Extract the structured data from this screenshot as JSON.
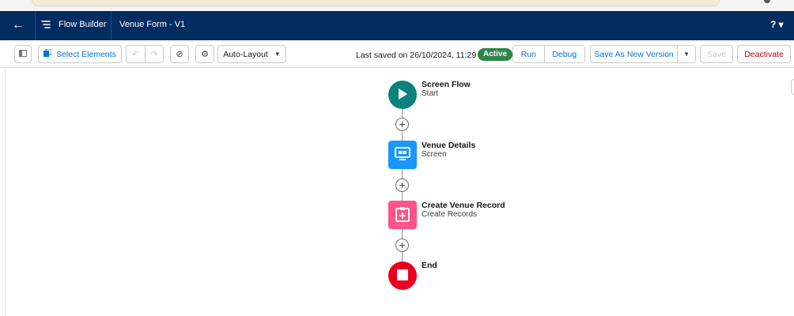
{
  "header": {
    "app_name": "Flow Builder",
    "flow_name": "Venue Form - V1",
    "help_label": "? ▾"
  },
  "toolbar": {
    "select_elements_label": "Select Elements",
    "layout_select_value": "Auto-Layout",
    "last_saved_text": "Last saved on 26/10/2024, 11:29 am",
    "status_badge": "Active",
    "run_label": "Run",
    "debug_label": "Debug",
    "save_as_new_version_label": "Save As New Version",
    "save_label": "Save",
    "deactivate_label": "Deactivate"
  },
  "flow": {
    "nodes": [
      {
        "title": "Screen Flow",
        "subtitle": "Start",
        "icon": "play-icon",
        "color": "#0b827c"
      },
      {
        "title": "Venue Details",
        "subtitle": "Screen",
        "icon": "screen-icon",
        "color": "#1b96ff"
      },
      {
        "title": "Create Venue Record",
        "subtitle": "Create Records",
        "icon": "create-record-icon",
        "color": "#ff538a"
      },
      {
        "title": "End",
        "subtitle": "",
        "icon": "stop-icon",
        "color": "#ea001e"
      }
    ],
    "add_element_symbol": "+"
  },
  "colors": {
    "header_bg": "#032d60",
    "brand_blue": "#0176d3",
    "active_green": "#2e844a",
    "deactivate_red": "#ba0517"
  }
}
